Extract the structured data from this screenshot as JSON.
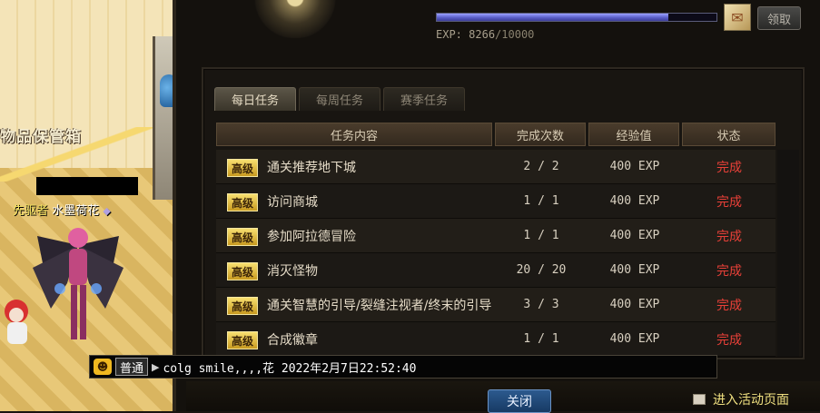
{
  "scene": {
    "signboard": "物品保管箱",
    "character_title": "先驱者",
    "character_name": "水墨荷花"
  },
  "header": {
    "exp_label": "EXP:",
    "exp_current": "8266",
    "exp_max": "/10000",
    "exp_progress": 0.8266,
    "claim_label": "领取",
    "reward_icon": "reward-chest-icon"
  },
  "tabs": [
    {
      "label": "每日任务",
      "active": true
    },
    {
      "label": "每周任务",
      "active": false
    },
    {
      "label": "赛季任务",
      "active": false
    }
  ],
  "table": {
    "headers": [
      "任务内容",
      "完成次数",
      "经验值",
      "状态"
    ],
    "rows": [
      {
        "badge": "高级",
        "task": "通关推荐地下城",
        "count": "2 / 2",
        "exp": "400 EXP",
        "status": "完成"
      },
      {
        "badge": "高级",
        "task": "访问商城",
        "count": "1 / 1",
        "exp": "400 EXP",
        "status": "完成"
      },
      {
        "badge": "高级",
        "task": "参加阿拉德冒险",
        "count": "1 / 1",
        "exp": "400 EXP",
        "status": "完成"
      },
      {
        "badge": "高级",
        "task": "消灭怪物",
        "count": "20 / 20",
        "exp": "400 EXP",
        "status": "完成"
      },
      {
        "badge": "高级",
        "task": "通关智慧的引导/裂缝注视者/终末的引导",
        "count": "3 / 3",
        "exp": "400 EXP",
        "status": "完成"
      },
      {
        "badge": "高级",
        "task": "合成徽章",
        "count": "1 / 1",
        "exp": "400 EXP",
        "status": "完成"
      }
    ]
  },
  "chat": {
    "channel": "普通",
    "message": "colg smile,,,,花 2022年2月7日22:52:40"
  },
  "footer": {
    "close_label": "关闭",
    "event_label": "进入活动页面"
  },
  "colors": {
    "status_complete": "#e84038",
    "badge_gold": "#f8e070",
    "exp_bar": "#5a5ec8"
  }
}
